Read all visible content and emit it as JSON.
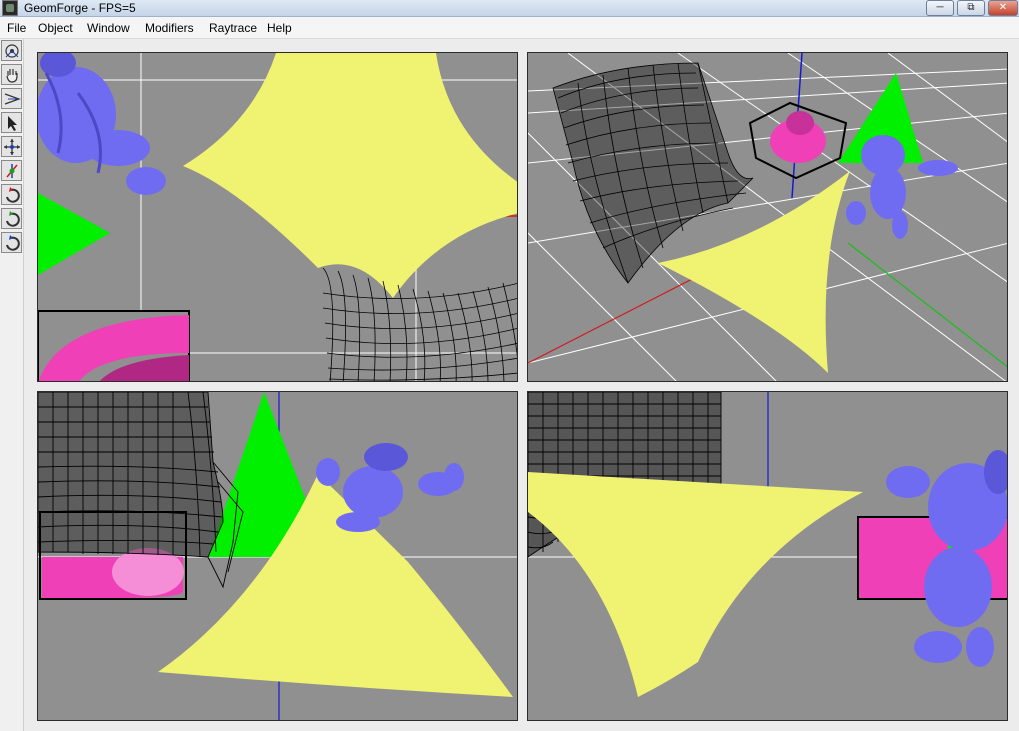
{
  "window": {
    "title": "GeomForge - FPS=5"
  },
  "menu": {
    "file": "File",
    "object": "Object",
    "window": "Window",
    "modifiers": "Modifiers",
    "raytrace": "Raytrace",
    "help": "Help"
  },
  "toolbar": {
    "tools": [
      "orbit-camera-icon",
      "pan-hand-icon",
      "zoom-camera-icon",
      "select-arrow-icon",
      "move-icon",
      "scale-icon",
      "rotate-x-icon",
      "rotate-y-icon",
      "rotate-z-icon"
    ]
  },
  "colors": {
    "viewport_bg": "#909090",
    "plane": "#f0f272",
    "cone": "#00f000",
    "torus": "#f040b8",
    "monster": "#6f6cf2",
    "wireframe": "#000000",
    "axis_x": "#d01818",
    "axis_y": "#18c018",
    "axis_z": "#1818d0",
    "grid": "#ffffff"
  },
  "viewports": [
    "top-view",
    "perspective-view",
    "front-view",
    "side-view"
  ]
}
